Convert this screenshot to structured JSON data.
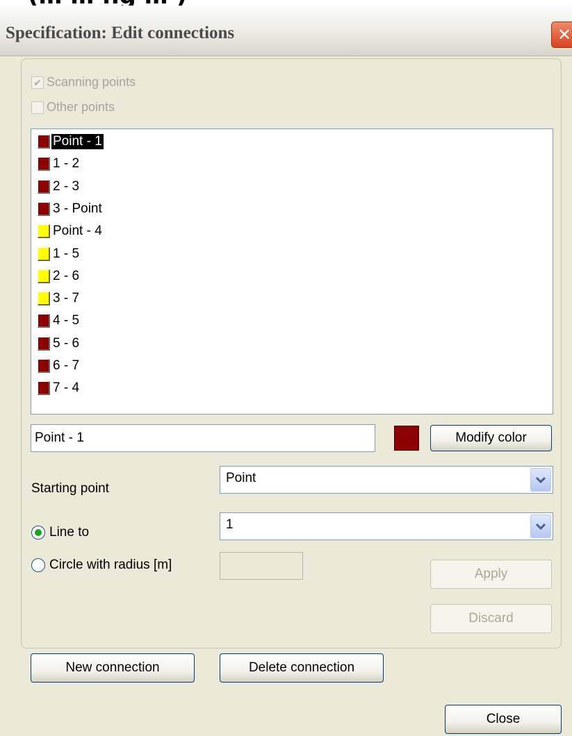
{
  "heading_fragment": "(… … ng … )",
  "window": {
    "title": "Specification: Edit connections",
    "close_glyph": "✕"
  },
  "filters": {
    "scanning_points": {
      "label": "Scanning points",
      "checked": true,
      "enabled": false
    },
    "other_points": {
      "label": "Other points",
      "checked": false,
      "enabled": false
    }
  },
  "connections": [
    {
      "label": "Point - 1",
      "color": "#8b0000",
      "selected": true
    },
    {
      "label": "1 - 2",
      "color": "#8b0000"
    },
    {
      "label": "2 - 3",
      "color": "#8b0000"
    },
    {
      "label": "3 - Point",
      "color": "#8b0000"
    },
    {
      "label": "Point - 4",
      "color": "#ffff00"
    },
    {
      "label": "1 - 5",
      "color": "#ffff00"
    },
    {
      "label": "2 - 6",
      "color": "#ffff00"
    },
    {
      "label": "3 - 7",
      "color": "#ffff00"
    },
    {
      "label": "4 - 5",
      "color": "#8b0000"
    },
    {
      "label": "5 - 6",
      "color": "#8b0000"
    },
    {
      "label": "6 - 7",
      "color": "#8b0000"
    },
    {
      "label": "7 - 4",
      "color": "#8b0000"
    }
  ],
  "editor": {
    "name_value": "Point - 1",
    "current_color": "#8b0000",
    "modify_color_label": "Modify color",
    "starting_point_label": "Starting point",
    "starting_point_value": "Point",
    "line_to_label": "Line to",
    "line_to_value": "1",
    "line_to_selected": true,
    "circle_label": "Circle with radius [m]",
    "circle_selected": false,
    "radius_value": "",
    "apply_label": "Apply",
    "discard_label": "Discard"
  },
  "footer": {
    "new_connection_label": "New connection",
    "delete_connection_label": "Delete connection",
    "close_label": "Close"
  },
  "icons": {
    "dropdown_arrow": "chevron-down-icon",
    "close": "close-icon",
    "check": "checkmark-icon"
  }
}
